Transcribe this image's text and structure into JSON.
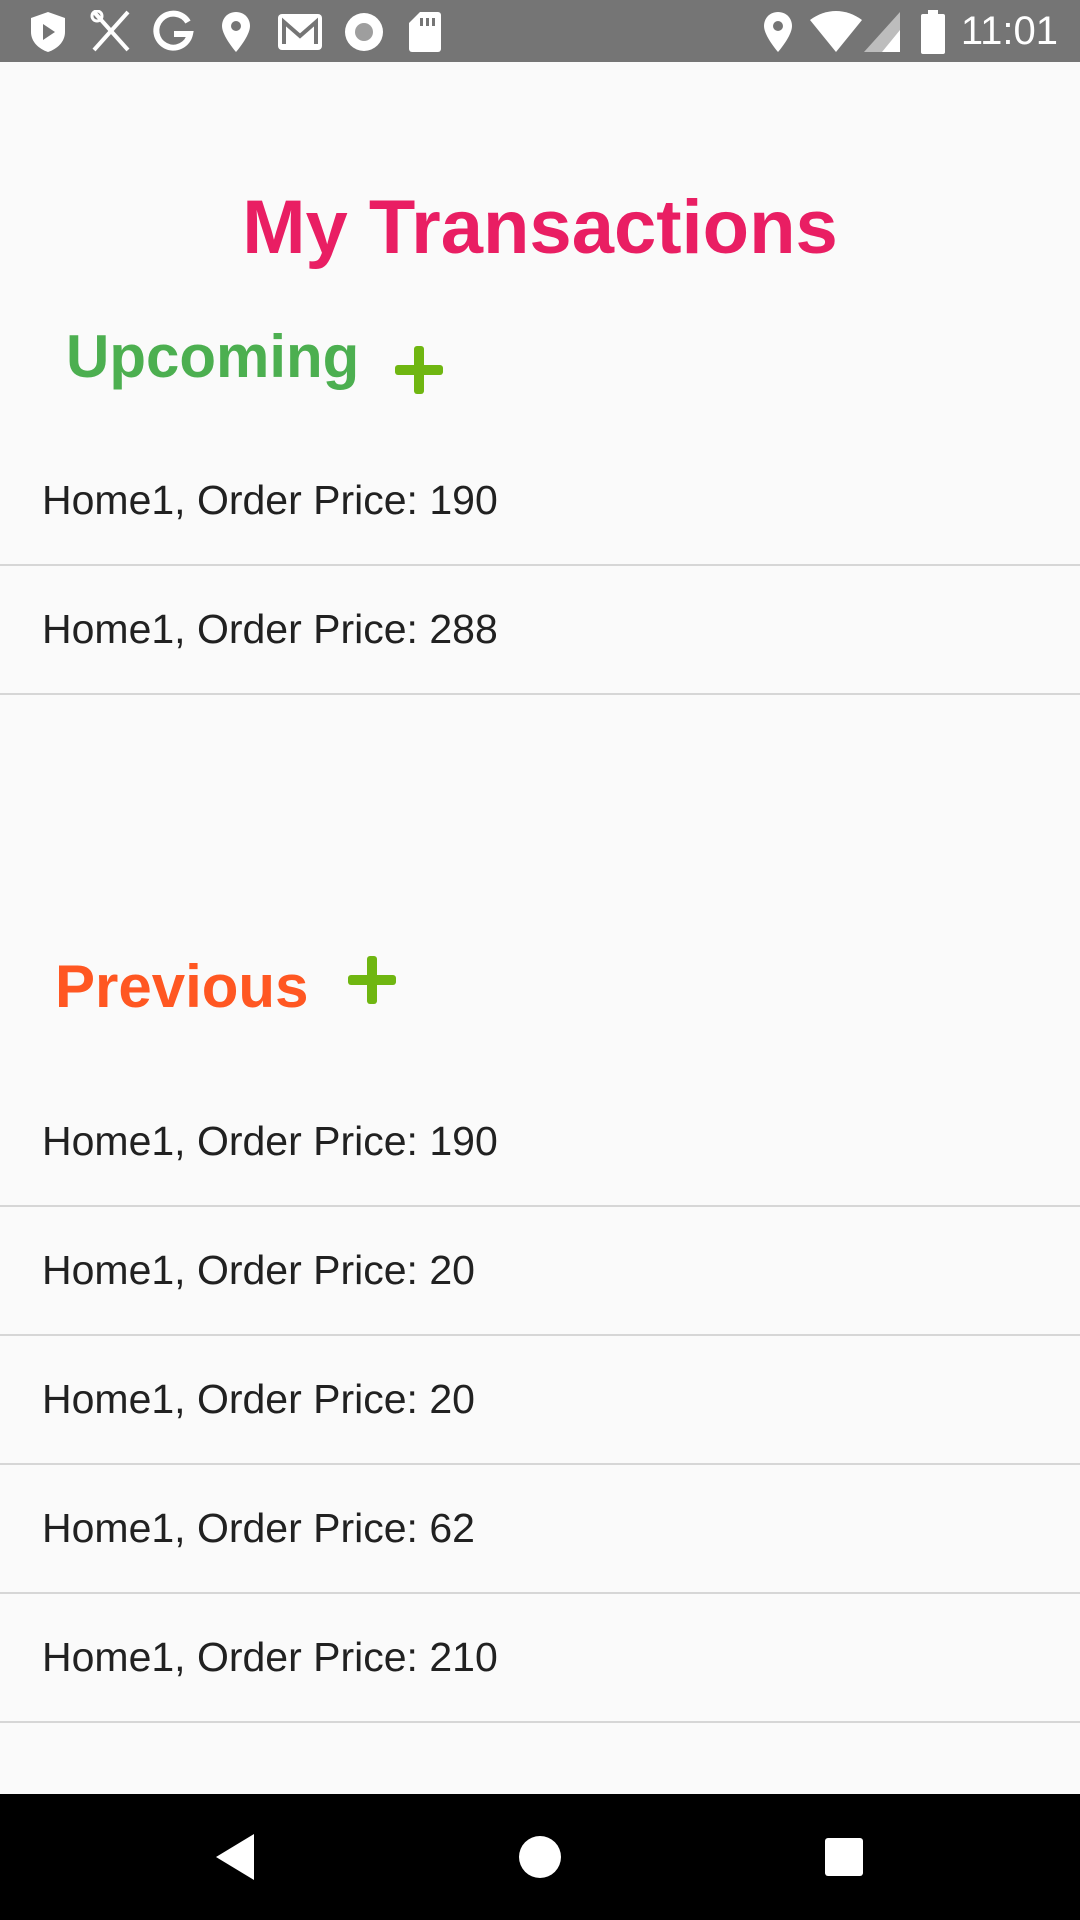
{
  "status_bar": {
    "time": "11:01",
    "left_icons": [
      "shield-icon",
      "restaurant-icon",
      "google-icon",
      "location-icon",
      "gmail-icon",
      "record-icon",
      "sd-card-icon"
    ],
    "right_icons": [
      "location-icon",
      "wifi-icon",
      "signal-icon",
      "battery-icon"
    ]
  },
  "page": {
    "title": "My Transactions"
  },
  "upcoming": {
    "label": "Upcoming",
    "items": [
      "Home1, Order Price: 190",
      "Home1, Order Price: 288"
    ]
  },
  "previous": {
    "label": "Previous",
    "items": [
      "Home1, Order Price: 190",
      "Home1, Order Price: 20",
      "Home1, Order Price: 20",
      "Home1, Order Price: 62",
      "Home1, Order Price: 210"
    ]
  },
  "colors": {
    "title": "#e91e63",
    "upcoming": "#4caf50",
    "previous": "#ff5722",
    "plus": "#6fb611",
    "status_bar": "#757575",
    "nav_bar": "#000000"
  },
  "nav_bar": {
    "buttons": [
      "back-icon",
      "home-icon",
      "recents-icon"
    ]
  }
}
